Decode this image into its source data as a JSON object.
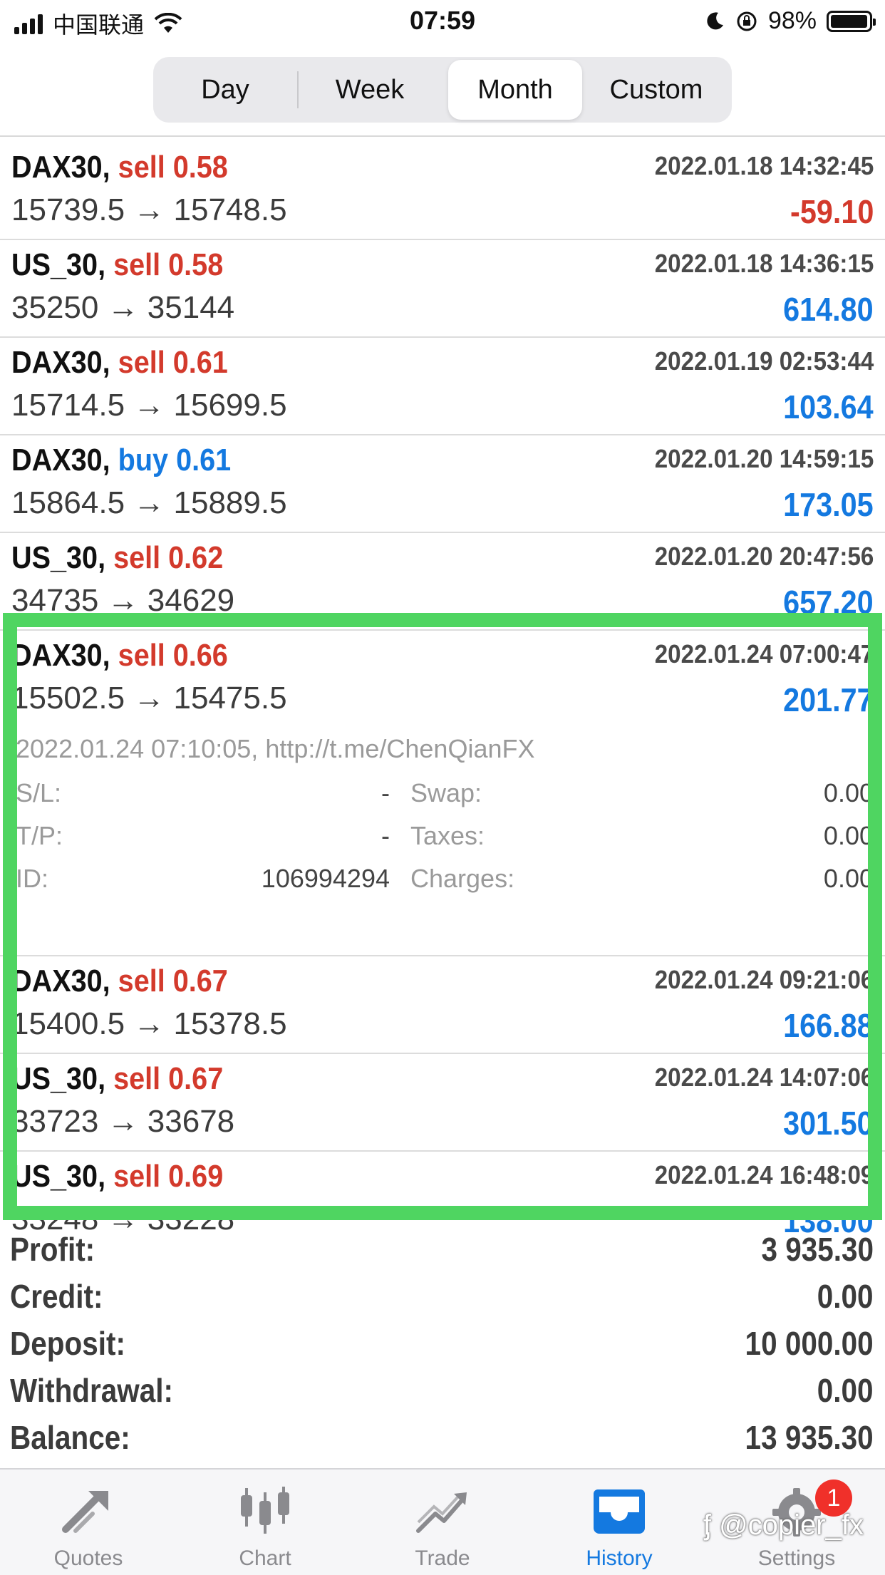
{
  "status_bar": {
    "carrier": "中国联通",
    "time": "07:59",
    "battery": "98%",
    "battery_level": 0.98
  },
  "period_tabs": [
    {
      "label": "Day",
      "active": false
    },
    {
      "label": "Week",
      "active": false
    },
    {
      "label": "Month",
      "active": true
    },
    {
      "label": "Custom",
      "active": false
    }
  ],
  "deals": [
    {
      "symbol": "DAX30,",
      "direction": "sell 0.58",
      "dir_class": "sell",
      "time": "2022.01.18 14:32:45",
      "prices": "15739.5 → 15748.5",
      "profit": "-59.10",
      "profit_class": "neg"
    },
    {
      "symbol": "US_30,",
      "direction": "sell 0.58",
      "dir_class": "sell",
      "time": "2022.01.18 14:36:15",
      "prices": "35250 → 35144",
      "profit": "614.80",
      "profit_class": "pos"
    },
    {
      "symbol": "DAX30,",
      "direction": "sell 0.61",
      "dir_class": "sell",
      "time": "2022.01.19 02:53:44",
      "prices": "15714.5 → 15699.5",
      "profit": "103.64",
      "profit_class": "pos"
    },
    {
      "symbol": "DAX30,",
      "direction": "buy 0.61",
      "dir_class": "buy",
      "time": "2022.01.20 14:59:15",
      "prices": "15864.5 → 15889.5",
      "profit": "173.05",
      "profit_class": "pos"
    },
    {
      "symbol": "US_30,",
      "direction": "sell 0.62",
      "dir_class": "sell",
      "time": "2022.01.20 20:47:56",
      "prices": "34735 → 34629",
      "profit": "657.20",
      "profit_class": "pos"
    },
    {
      "symbol": "DAX30,",
      "direction": "sell 0.66",
      "dir_class": "sell",
      "time": "2022.01.24 07:00:47",
      "prices": "15502.5 → 15475.5",
      "profit": "201.77",
      "profit_class": "pos"
    },
    {
      "symbol": "DAX30,",
      "direction": "sell 0.67",
      "dir_class": "sell",
      "time": "2022.01.24 09:21:06",
      "prices": "15400.5 → 15378.5",
      "profit": "166.88",
      "profit_class": "pos"
    },
    {
      "symbol": "US_30,",
      "direction": "sell 0.67",
      "dir_class": "sell",
      "time": "2022.01.24 14:07:06",
      "prices": "33723 → 33678",
      "profit": "301.50",
      "profit_class": "pos"
    },
    {
      "symbol": "US_30,",
      "direction": "sell 0.69",
      "dir_class": "sell",
      "time": "2022.01.24 16:48:09",
      "prices": "33248 → 33228",
      "profit": "138.00",
      "profit_class": "pos"
    }
  ],
  "expanded": {
    "info": "2022.01.24 07:10:05, http://t.me/ChenQianFX",
    "sl_label": "S/L:",
    "sl_value": "-",
    "tp_label": "T/P:",
    "tp_value": "-",
    "id_label": "ID:",
    "id_value": "106994294",
    "swap_label": "Swap:",
    "swap_value": "0.00",
    "taxes_label": "Taxes:",
    "taxes_value": "0.00",
    "charges_label": "Charges:",
    "charges_value": "0.00"
  },
  "summary": [
    {
      "label": "Profit:",
      "value": "3 935.30"
    },
    {
      "label": "Credit:",
      "value": "0.00"
    },
    {
      "label": "Deposit:",
      "value": "10 000.00"
    },
    {
      "label": "Withdrawal:",
      "value": "0.00"
    },
    {
      "label": "Balance:",
      "value": "13 935.30"
    }
  ],
  "tabbar": [
    {
      "label": "Quotes",
      "icon": "quotes-icon"
    },
    {
      "label": "Chart",
      "icon": "chart-icon"
    },
    {
      "label": "Trade",
      "icon": "trade-icon"
    },
    {
      "label": "History",
      "icon": "history-icon",
      "active": true
    },
    {
      "label": "Settings",
      "icon": "settings-icon",
      "badge": "1"
    }
  ],
  "watermark": "@copier_fx",
  "colors": {
    "sell": "#d33a2c",
    "buy": "#1479e0",
    "highlight": "#4fd561",
    "active_tab": "#1479e0"
  }
}
